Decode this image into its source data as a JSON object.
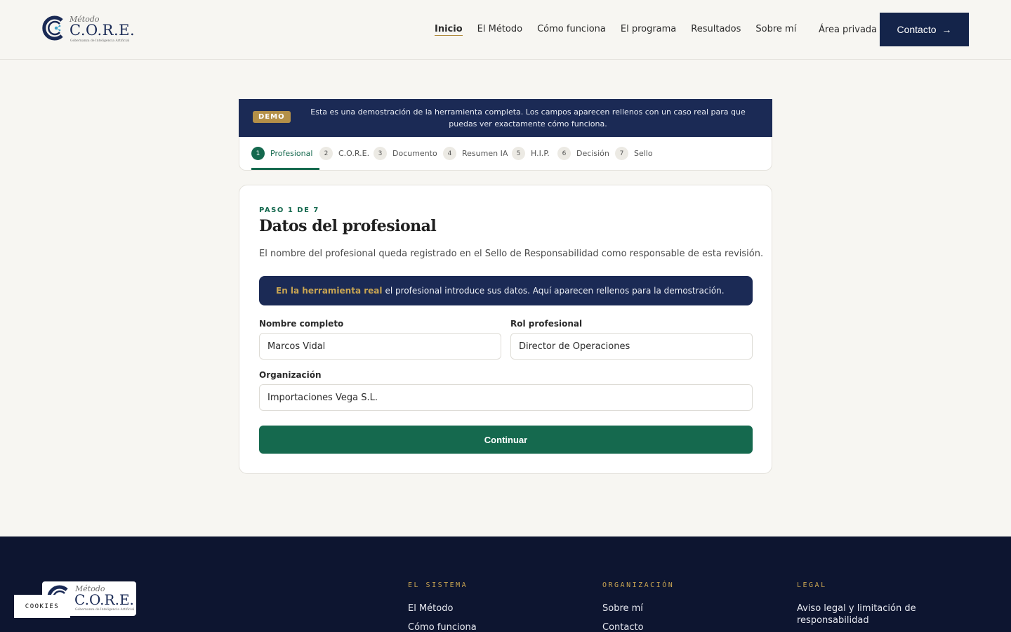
{
  "header": {
    "logo": {
      "metodo": "Método",
      "core": "C.O.R.E.",
      "tagline": "Gobernanza de Inteligencia Artificial"
    },
    "nav": [
      {
        "label": "Inicio",
        "active": true
      },
      {
        "label": "El Método",
        "active": false
      },
      {
        "label": "Cómo funciona",
        "active": false
      },
      {
        "label": "El programa",
        "active": false
      },
      {
        "label": "Resultados",
        "active": false
      },
      {
        "label": "Sobre mí",
        "active": false
      }
    ],
    "area_privada": "Área privada",
    "contact_label": "Contacto",
    "contact_arrow": "→"
  },
  "demo": {
    "badge": "DEMO",
    "text": "Esta es una demostración de la herramienta completa. Los campos aparecen rellenos con un caso real para que puedas ver exactamente cómo funciona."
  },
  "steps": [
    {
      "num": "1",
      "label": "Profesional",
      "active": true
    },
    {
      "num": "2",
      "label": "C.O.R.E.",
      "active": false
    },
    {
      "num": "3",
      "label": "Documento",
      "active": false
    },
    {
      "num": "4",
      "label": "Resumen IA",
      "active": false
    },
    {
      "num": "5",
      "label": "H.I.P.",
      "active": false
    },
    {
      "num": "6",
      "label": "Decisión",
      "active": false
    },
    {
      "num": "7",
      "label": "Sello",
      "active": false
    }
  ],
  "card": {
    "eyebrow": "PASO 1 DE 7",
    "title": "Datos del profesional",
    "description": "El nombre del profesional queda registrado en el Sello de Responsabilidad como responsable de esta revisión.",
    "info_highlight": "En la herramienta real",
    "info_text": "el profesional introduce sus datos. Aquí aparecen rellenos para la demostración.",
    "fields": {
      "nombre": {
        "label": "Nombre completo",
        "value": "Marcos Vidal"
      },
      "rol": {
        "label": "Rol profesional",
        "value": "Director de Operaciones"
      },
      "organizacion": {
        "label": "Organización",
        "value": "Importaciones Vega S.L."
      }
    },
    "continue_label": "Continuar"
  },
  "footer": {
    "logo": {
      "metodo": "Método",
      "core": "C.O.R.E.",
      "tagline": "Gobernanza de Inteligencia Artificial"
    },
    "cookies_label": "COOKIES",
    "columns": [
      {
        "title": "EL SISTEMA",
        "links": [
          "El Método",
          "Cómo funciona"
        ]
      },
      {
        "title": "ORGANIZACIÓN",
        "links": [
          "Sobre mí",
          "Contacto"
        ]
      },
      {
        "title": "LEGAL",
        "links": [
          "Aviso legal y limitación de responsabilidad"
        ]
      }
    ]
  },
  "colors": {
    "navy": "#14244a",
    "green": "#15694e",
    "gold": "#b49048",
    "background": "#f7f6f2",
    "footer": "#0d1530"
  }
}
